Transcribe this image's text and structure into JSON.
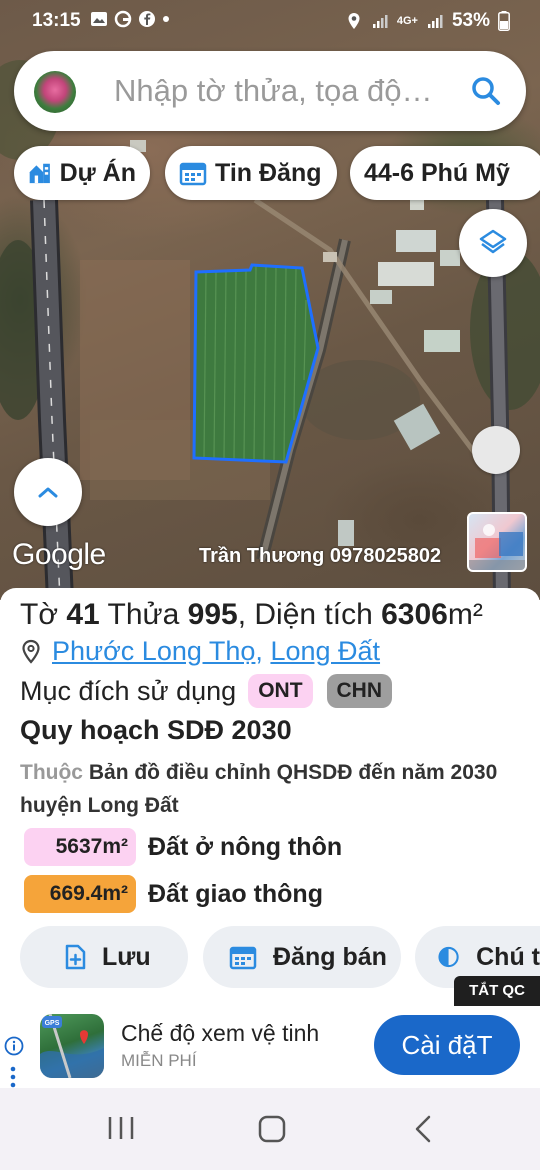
{
  "status_bar": {
    "time": "13:15",
    "network": "4G+",
    "battery": "53%"
  },
  "search": {
    "placeholder": "Nhập tờ thửa, tọa độ…"
  },
  "chips": [
    {
      "label": "Dự Án",
      "icon": "city-icon"
    },
    {
      "label": "Tin Đăng",
      "icon": "calendar-icon"
    },
    {
      "label": "44-6 Phú Mỹ",
      "icon": ""
    }
  ],
  "map": {
    "attribution": "Google",
    "watermark": "Trần Thương 0978025802"
  },
  "parcel": {
    "sheet_label": "Tờ",
    "sheet_no": "41",
    "lot_label": "Thửa",
    "lot_no": "995",
    "area_label": "Diện tích",
    "area_value": "6306",
    "area_unit": "m²",
    "ward": "Phước Long Thọ",
    "district": "Long Đất",
    "purpose_label": "Mục đích sử dụng",
    "purpose_tags": [
      "ONT",
      "CHN"
    ]
  },
  "plan": {
    "title": "Quy hoạch SDĐ 2030",
    "desc_prefix": "Thuộc",
    "desc": "Bản đồ điều chỉnh QHSDĐ đến năm 2030 huyện Long Đất",
    "areas": [
      {
        "value": "5637m²",
        "label": "Đất ở nông thôn",
        "color": "#fcd2f2"
      },
      {
        "value": "669.4m²",
        "label": "Đất giao thông",
        "color": "#f5a43a"
      }
    ]
  },
  "actions": [
    {
      "label": "Lưu",
      "icon": "add-file-icon"
    },
    {
      "label": "Đăng bán",
      "icon": "calendar-icon"
    },
    {
      "label": "Chú t",
      "icon": "contrast-icon"
    }
  ],
  "ad": {
    "close_label": "TẮT QC",
    "title": "Chế độ xem vệ tinh",
    "subtitle": "MIỄN PHÍ",
    "install_label": "Cài đặT",
    "app_badge": "GPS"
  },
  "colors": {
    "accent": "#2b8be0",
    "install_button": "#1a68c9",
    "parcel_outline": "#1f6fff",
    "tag_ont": "#fcd2f2",
    "tag_chn": "#9e9e9e"
  }
}
